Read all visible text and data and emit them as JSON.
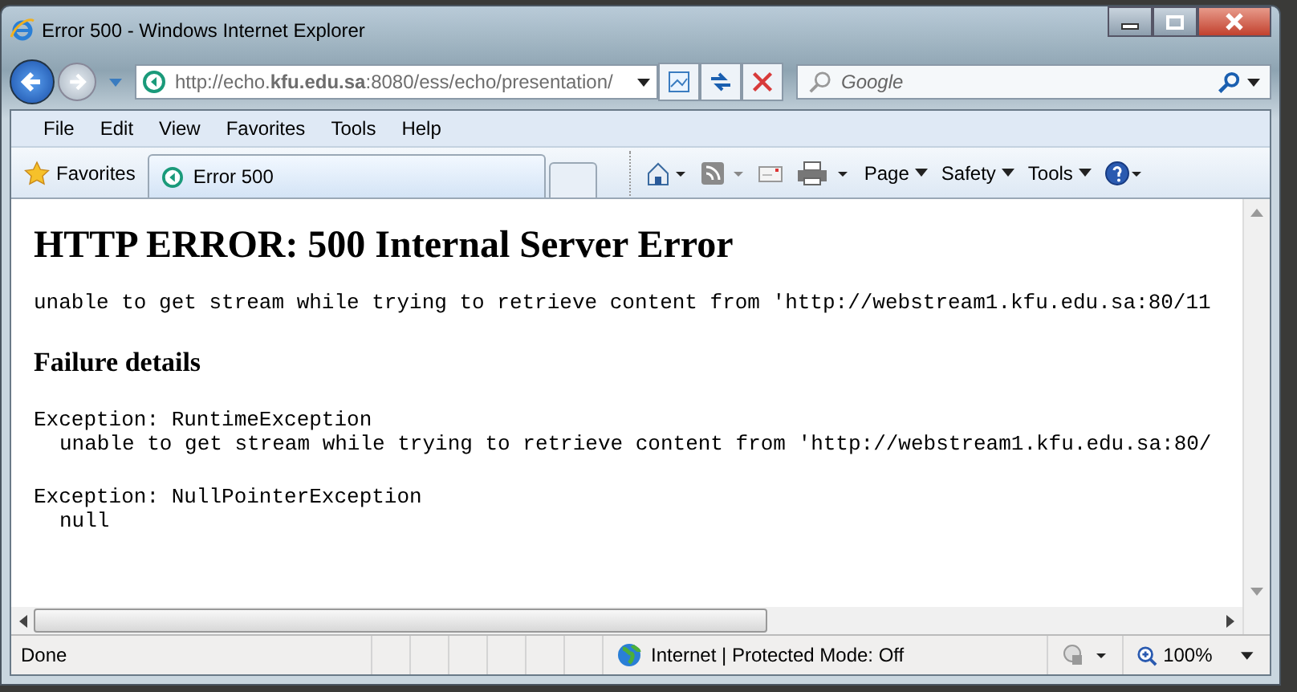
{
  "window": {
    "title": "Error 500 - Windows Internet Explorer"
  },
  "address_bar": {
    "url": "http://echo.**kfu.edu.sa**:8080/ess/echo/presentation/"
  },
  "search": {
    "placeholder": "Google"
  },
  "menu": [
    "File",
    "Edit",
    "View",
    "Favorites",
    "Tools",
    "Help"
  ],
  "favorites_bar": {
    "favorites": "Favorites",
    "tab": "Error 500",
    "commands": [
      {
        "kind": "home"
      },
      {
        "kind": "feeds"
      },
      {
        "kind": "mail"
      },
      {
        "kind": "print"
      },
      {
        "kind": "menu",
        "label": "Page"
      },
      {
        "kind": "menu",
        "label": "Safety"
      },
      {
        "kind": "menu",
        "label": "Tools"
      },
      {
        "kind": "help"
      }
    ]
  },
  "page": {
    "heading": "HTTP ERROR: 500 Internal Server Error",
    "message": "unable to get stream while trying to retrieve content from 'http://webstream1.kfu.edu.sa:80/11",
    "subheading": "Failure details",
    "exceptions": [
      {
        "title": "Exception: RuntimeException",
        "detail": "unable to get stream while trying to retrieve content from 'http://webstream1.kfu.edu.sa:80/"
      },
      {
        "title": "Exception: NullPointerException",
        "detail": "null"
      }
    ]
  },
  "status_bar": {
    "status": "Done",
    "zone": "Internet | Protected Mode: Off",
    "zoom": "100%"
  }
}
